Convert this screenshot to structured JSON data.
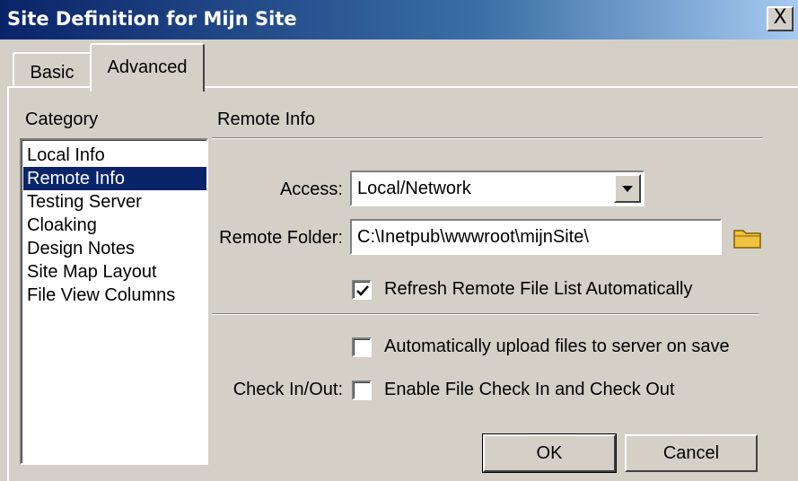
{
  "window": {
    "title": "Site Definition for Mijn Site",
    "close_label": "X"
  },
  "tabs": [
    {
      "label": "Basic",
      "selected": false
    },
    {
      "label": "Advanced",
      "selected": true
    }
  ],
  "category": {
    "label": "Category",
    "items": [
      {
        "label": "Local Info"
      },
      {
        "label": "Remote Info",
        "selected": true
      },
      {
        "label": "Testing Server"
      },
      {
        "label": "Cloaking"
      },
      {
        "label": "Design Notes"
      },
      {
        "label": "Site Map Layout"
      },
      {
        "label": "File View Columns"
      }
    ]
  },
  "section_title": "Remote Info",
  "access": {
    "label": "Access:",
    "value": "Local/Network"
  },
  "remote_folder": {
    "label": "Remote Folder:",
    "value": "C:\\Inetpub\\wwwroot\\mijnSite\\",
    "browse_icon": "folder-icon"
  },
  "refresh_checkbox": {
    "label": "Refresh Remote File List Automatically",
    "checked": true
  },
  "auto_upload_checkbox": {
    "label": "Automatically upload files to server on save",
    "checked": false
  },
  "check_in_out": {
    "label": "Check In/Out:",
    "checkbox_label": "Enable File Check In and Check Out",
    "checked": false
  },
  "buttons": {
    "ok": "OK",
    "cancel": "Cancel"
  },
  "colors": {
    "selection": "#0a246a",
    "face": "#d4d0c8",
    "folder": "#f0c040"
  }
}
